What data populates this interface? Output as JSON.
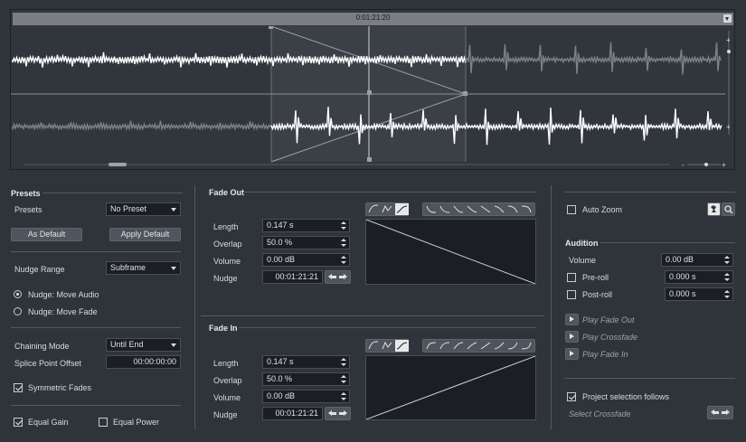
{
  "waveform": {
    "time_label": "0:01:21:20"
  },
  "presets": {
    "title": "Presets",
    "presets_label": "Presets",
    "preset_value": "No Preset",
    "as_default": "As Default",
    "apply_default": "Apply Default",
    "nudge_range_label": "Nudge Range",
    "nudge_range_value": "Subframe",
    "nudge_move_audio": "Nudge: Move Audio",
    "nudge_move_fade": "Nudge: Move Fade",
    "nudge_mode_selected": "Nudge: Move Audio",
    "chaining_mode_label": "Chaining Mode",
    "chaining_mode_value": "Until End",
    "splice_label": "Splice Point Offset",
    "splice_value": "00:00:00:00",
    "symmetric_fades": "Symmetric Fades",
    "symmetric_checked": true,
    "equal_gain": "Equal Gain",
    "equal_gain_checked": true,
    "equal_power": "Equal Power",
    "equal_power_checked": false
  },
  "fade_out": {
    "title": "Fade Out",
    "length_label": "Length",
    "length_value": "0.147 s",
    "overlap_label": "Overlap",
    "overlap_value": "50.0 %",
    "volume_label": "Volume",
    "volume_value": "0.00 dB",
    "nudge_label": "Nudge",
    "nudge_value": "00:01:21:21"
  },
  "fade_in": {
    "title": "Fade In",
    "length_label": "Length",
    "length_value": "0.147 s",
    "overlap_label": "Overlap",
    "overlap_value": "50.0 %",
    "volume_label": "Volume",
    "volume_value": "0.00 dB",
    "nudge_label": "Nudge",
    "nudge_value": "00:01:21:21"
  },
  "right": {
    "auto_zoom": "Auto Zoom",
    "auto_zoom_checked": false,
    "audition_title": "Audition",
    "volume_label": "Volume",
    "volume_value": "0.00 dB",
    "preroll_label": "Pre-roll",
    "preroll_value": "0.000 s",
    "preroll_checked": false,
    "postroll_label": "Post-roll",
    "postroll_value": "0.000 s",
    "postroll_checked": false,
    "play_fade_out": "Play Fade Out",
    "play_crossfade": "Play Crossfade",
    "play_fade_in": "Play Fade In",
    "project_selection": "Project selection follows",
    "project_selection_checked": true,
    "select_crossfade": "Select Crossfade"
  },
  "colors": {
    "background": "#2f343b",
    "waveform_active": "#ffffff",
    "waveform_inactive": "#7d8188",
    "crossfade_region": "#3c4148",
    "field_bg": "#1b1e22"
  }
}
